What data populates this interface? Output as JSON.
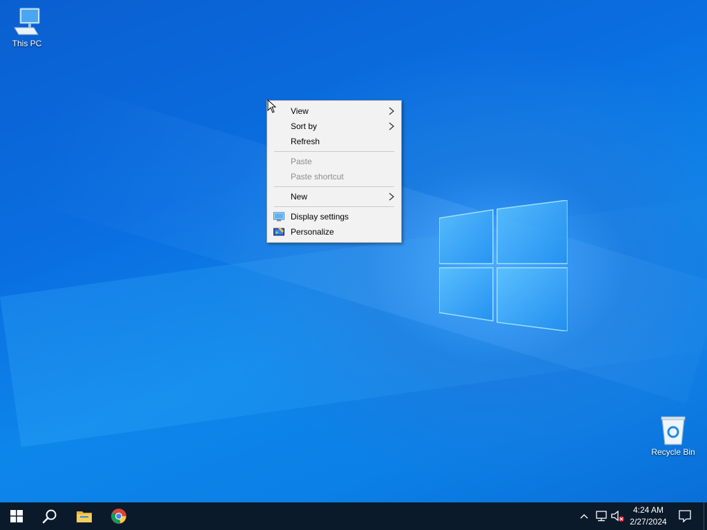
{
  "desktop": {
    "icons": [
      {
        "label": "This PC",
        "icon": "computer-icon"
      },
      {
        "label": "Recycle Bin",
        "icon": "recycle-bin-icon"
      }
    ]
  },
  "context_menu": {
    "items": [
      {
        "label": "View",
        "has_submenu": true,
        "enabled": true
      },
      {
        "label": "Sort by",
        "has_submenu": true,
        "enabled": true
      },
      {
        "label": "Refresh",
        "has_submenu": false,
        "enabled": true
      },
      {
        "label": "Paste",
        "has_submenu": false,
        "enabled": false
      },
      {
        "label": "Paste shortcut",
        "has_submenu": false,
        "enabled": false
      },
      {
        "label": "New",
        "has_submenu": true,
        "enabled": true
      },
      {
        "label": "Display settings",
        "icon": "display-icon",
        "enabled": true
      },
      {
        "label": "Personalize",
        "icon": "personalize-icon",
        "enabled": true
      }
    ]
  },
  "taskbar": {
    "pinned": [
      {
        "name": "Start",
        "icon": "windows-icon"
      },
      {
        "name": "Search",
        "icon": "search-icon"
      },
      {
        "name": "File Explorer",
        "icon": "folder-icon"
      },
      {
        "name": "Google Chrome",
        "icon": "chrome-icon"
      }
    ],
    "tray": {
      "icons": [
        "chevron-up-icon",
        "network-icon",
        "volume-muted-icon"
      ],
      "time": "4:24 AM",
      "date": "2/27/2024"
    },
    "notification_icon": "notification-icon"
  },
  "colors": {
    "desktop_blue": "#0a6ee0",
    "taskbar": "#0b1a2b",
    "menu_bg": "#f2f2f2",
    "disabled_text": "#8c8c8c"
  }
}
